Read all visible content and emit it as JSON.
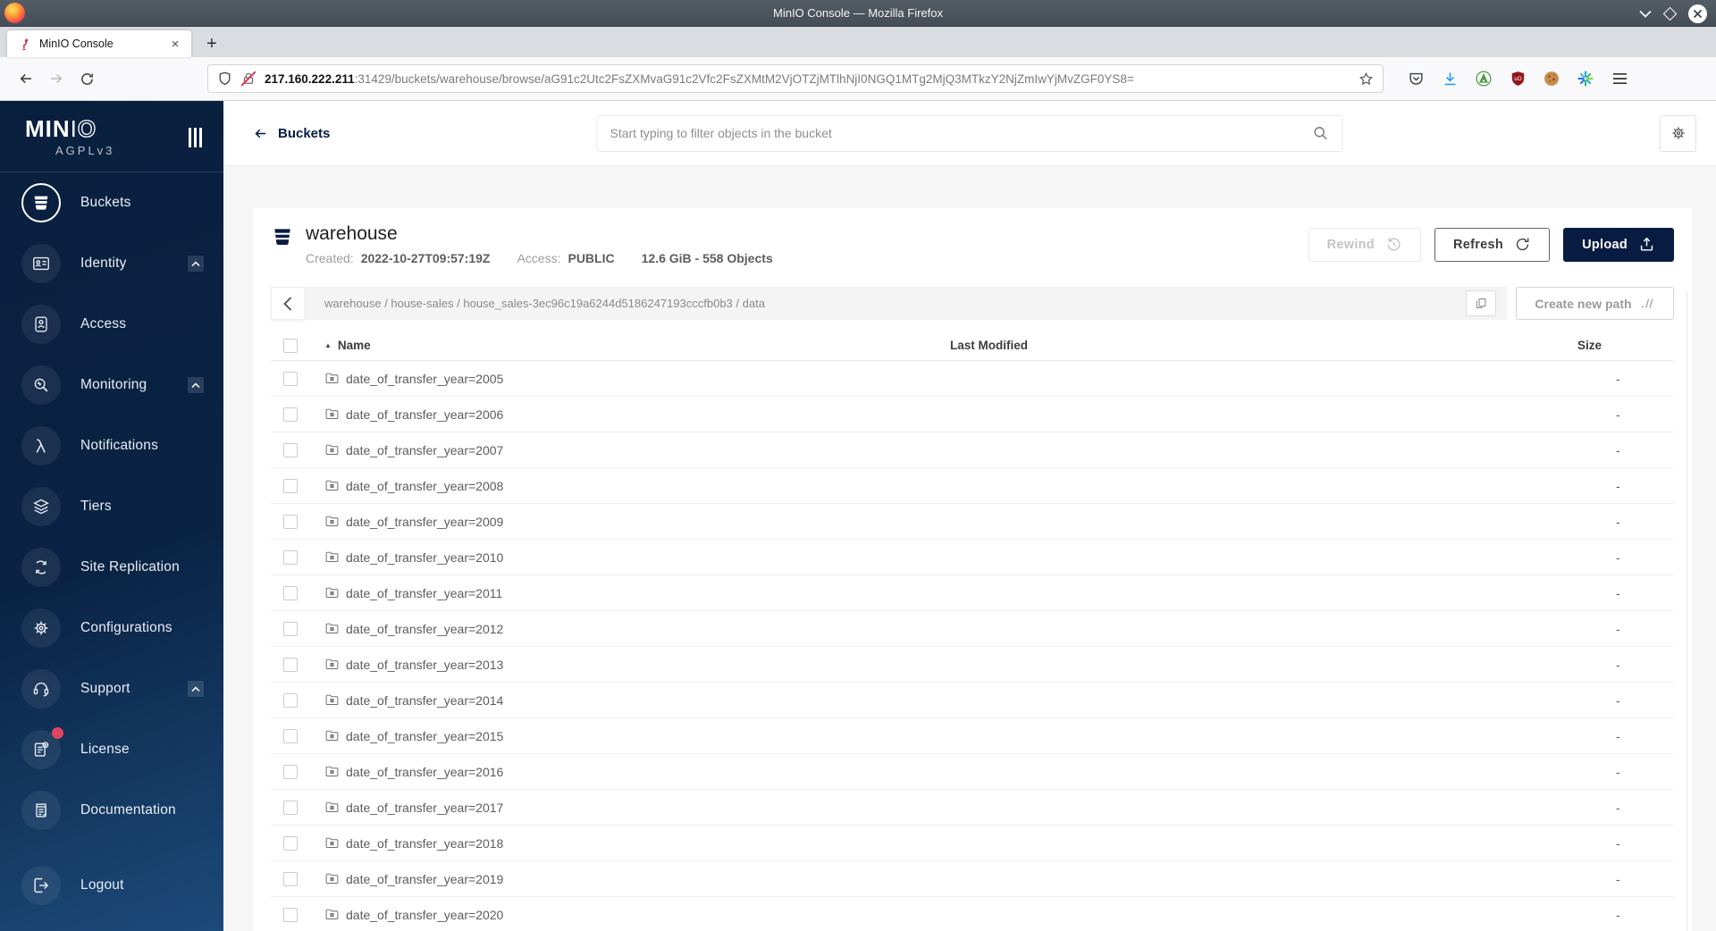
{
  "window": {
    "title": "MinIO Console — Mozilla Firefox"
  },
  "browser": {
    "tab_label": "MinIO Console",
    "tab_close": "×",
    "new_tab": "+",
    "url_host": "217.160.222.211",
    "url_rest": ":31429/buckets/warehouse/browse/aG91c2Utc2FsZXMvaG91c2Vfc2FsZXMtM2VjOTZjMTlhNjI0NGQ1MTg2MjQ3MTkzY2NjZmIwYjMvZGF0YS8="
  },
  "sidebar": {
    "brand_solid": "MIN",
    "brand_i": "I",
    "brand_outline": "O",
    "license": "AGPLv3",
    "items": [
      {
        "label": "Buckets"
      },
      {
        "label": "Identity"
      },
      {
        "label": "Access"
      },
      {
        "label": "Monitoring"
      },
      {
        "label": "Notifications"
      },
      {
        "label": "Tiers"
      },
      {
        "label": "Site Replication"
      },
      {
        "label": "Configurations"
      },
      {
        "label": "Support"
      },
      {
        "label": "License"
      },
      {
        "label": "Documentation"
      },
      {
        "label": "Logout"
      }
    ]
  },
  "header": {
    "back_label": "Buckets",
    "search_placeholder": "Start typing to filter objects in the bucket"
  },
  "bucket": {
    "name": "warehouse",
    "created_label": "Created:",
    "created_value": "2022-10-27T09:57:19Z",
    "access_label": "Access:",
    "access_value": "PUBLIC",
    "usage": "12.6 GiB - 558 Objects"
  },
  "actions": {
    "rewind": "Rewind",
    "refresh": "Refresh",
    "upload": "Upload",
    "create_path": "Create new path"
  },
  "path": {
    "breadcrumb": "warehouse / house-sales / house_sales-3ec96c19a6244d5186247193cccfb0b3 / data"
  },
  "table": {
    "sort_indicator": "▲",
    "columns": {
      "name": "Name",
      "last_modified": "Last Modified",
      "size": "Size"
    },
    "rows": [
      {
        "name": "date_of_transfer_year=2005",
        "size": "-"
      },
      {
        "name": "date_of_transfer_year=2006",
        "size": "-"
      },
      {
        "name": "date_of_transfer_year=2007",
        "size": "-"
      },
      {
        "name": "date_of_transfer_year=2008",
        "size": "-"
      },
      {
        "name": "date_of_transfer_year=2009",
        "size": "-"
      },
      {
        "name": "date_of_transfer_year=2010",
        "size": "-"
      },
      {
        "name": "date_of_transfer_year=2011",
        "size": "-"
      },
      {
        "name": "date_of_transfer_year=2012",
        "size": "-"
      },
      {
        "name": "date_of_transfer_year=2013",
        "size": "-"
      },
      {
        "name": "date_of_transfer_year=2014",
        "size": "-"
      },
      {
        "name": "date_of_transfer_year=2015",
        "size": "-"
      },
      {
        "name": "date_of_transfer_year=2016",
        "size": "-"
      },
      {
        "name": "date_of_transfer_year=2017",
        "size": "-"
      },
      {
        "name": "date_of_transfer_year=2018",
        "size": "-"
      },
      {
        "name": "date_of_transfer_year=2019",
        "size": "-"
      },
      {
        "name": "date_of_transfer_year=2020",
        "size": "-"
      }
    ]
  },
  "colors": {
    "accent_navy": "#081C42",
    "minio_red": "#C72C48",
    "badge_red": "#E0455F",
    "download_blue": "#2E9EF7"
  }
}
